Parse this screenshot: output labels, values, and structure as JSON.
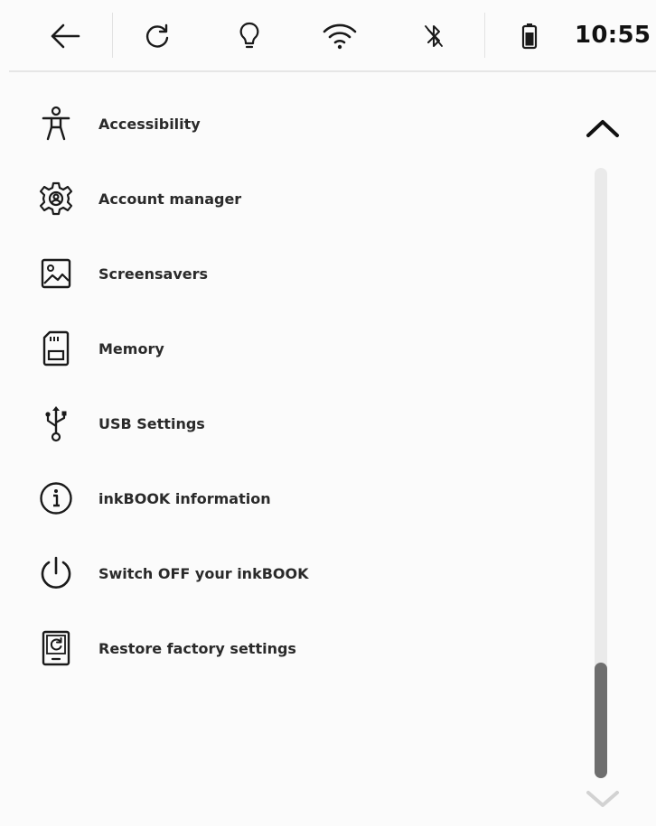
{
  "status_bar": {
    "icons": [
      "back-arrow-icon",
      "refresh-icon",
      "frontlight-bulb-icon",
      "wifi-icon",
      "bluetooth-icon",
      "battery-icon"
    ],
    "time": "10:55"
  },
  "settings_menu": {
    "items": [
      {
        "icon": "accessibility-icon",
        "label": "Accessibility"
      },
      {
        "icon": "gear-icon",
        "label": "Account manager"
      },
      {
        "icon": "image-icon",
        "label": "Screensavers"
      },
      {
        "icon": "sd-card-icon",
        "label": "Memory"
      },
      {
        "icon": "usb-icon",
        "label": "USB Settings"
      },
      {
        "icon": "info-icon",
        "label": "inkBOOK information"
      },
      {
        "icon": "power-icon",
        "label": "Switch OFF your inkBOOK"
      },
      {
        "icon": "restore-device-icon",
        "label": "Restore factory settings"
      }
    ]
  },
  "scrollbar": {
    "up_icon": "chevron-up-icon",
    "down_icon": "chevron-down-icon",
    "thumb_start_fraction": 0.81,
    "thumb_end_fraction": 1.0
  },
  "colors": {
    "background": "#fbfbfb",
    "icon": "#1a1a1a",
    "scroll_thumb": "#6e6e6e",
    "scroll_track": "#eaeaea"
  }
}
